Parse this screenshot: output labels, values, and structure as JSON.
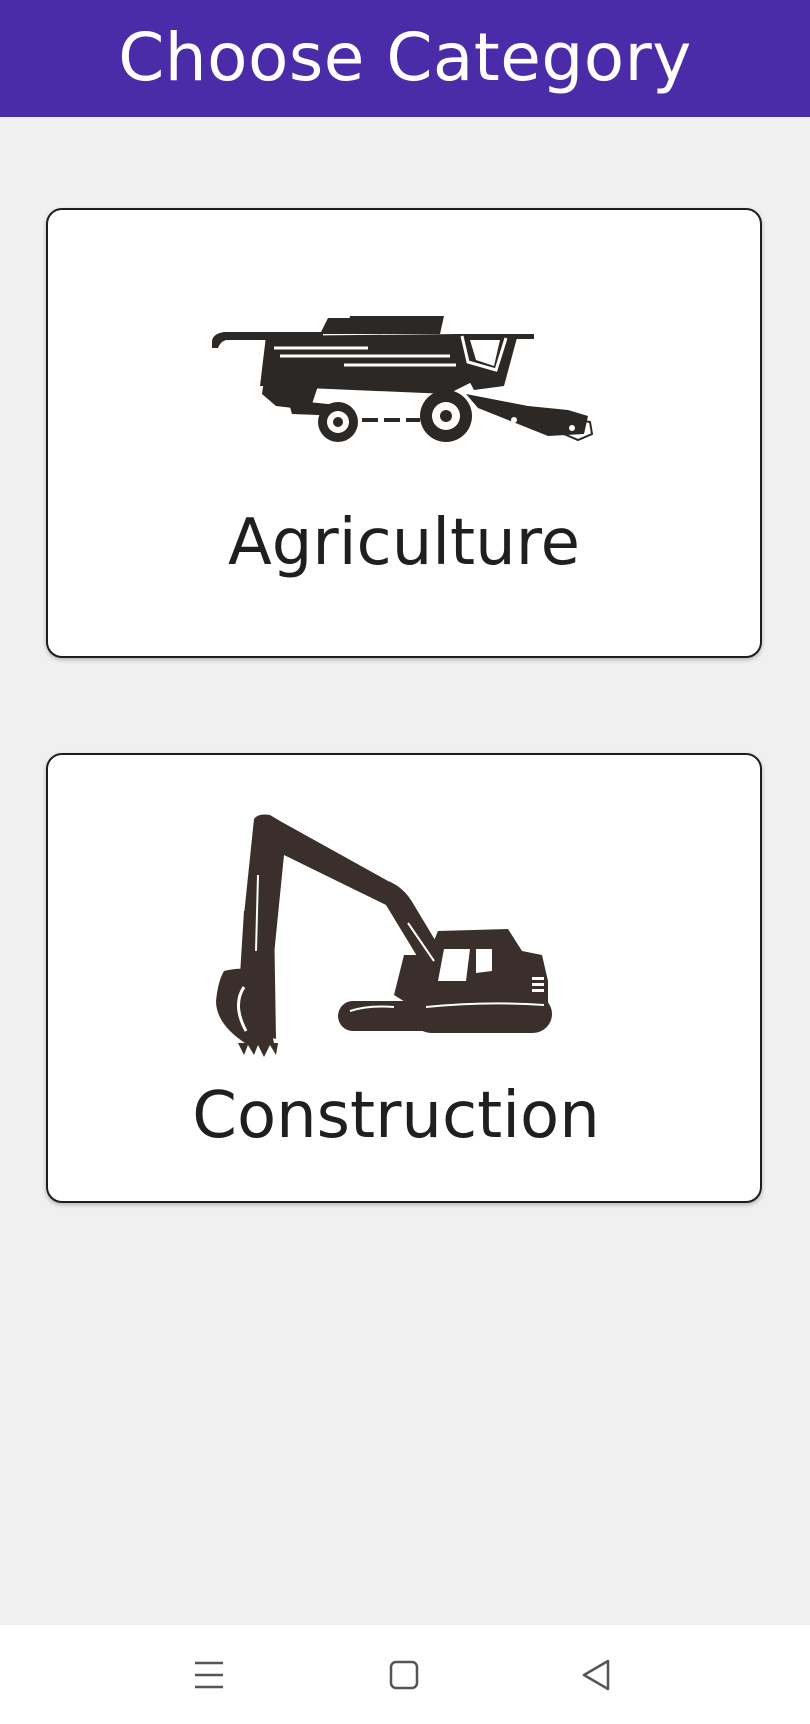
{
  "header": {
    "title": "Choose Category",
    "background": "#4b2ca8"
  },
  "categories": [
    {
      "label": "Agriculture",
      "icon": "combine-harvester-icon"
    },
    {
      "label": "Construction",
      "icon": "excavator-icon"
    }
  ],
  "navbar": {
    "buttons": [
      "menu-icon",
      "home-icon",
      "back-icon"
    ]
  },
  "colors": {
    "icon_fill": "#2b2826",
    "excavator_fill": "#3a2f2b",
    "background": "#f0f0f0"
  }
}
